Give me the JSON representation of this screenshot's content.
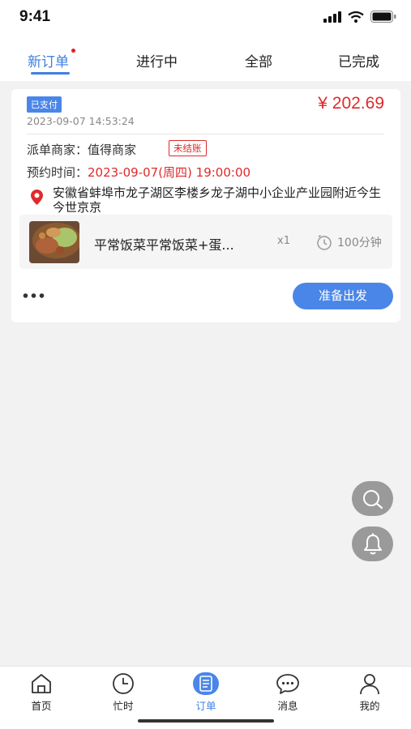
{
  "status_bar": {
    "time": "9:41"
  },
  "tabs": [
    {
      "label": "新订单",
      "active": true,
      "has_dot": true
    },
    {
      "label": "进行中",
      "active": false
    },
    {
      "label": "全部",
      "active": false
    },
    {
      "label": "已完成",
      "active": false
    }
  ],
  "order": {
    "status_badge": "已支付",
    "price": "¥ 202.69",
    "created_at": "2023-09-07 14:53:24",
    "merchant_label": "派单商家：值得商家",
    "settlement_badge": "未结账",
    "appointment_label": "预约时间：",
    "appointment_value": "2023-09-07(周四) 19:00:00",
    "address": "安徽省蚌埠市龙子湖区李楼乡龙子湖中小企业产业园附近今生今世京京",
    "item": {
      "name": "平常饭菜平常饭菜+蛋...",
      "quantity": "x1",
      "duration": "100分钟"
    },
    "action_button": "准备出发"
  },
  "bottom_nav": [
    {
      "label": "首页",
      "icon": "home-icon",
      "active": false
    },
    {
      "label": "忙时",
      "icon": "clock-icon",
      "active": false
    },
    {
      "label": "订单",
      "icon": "order-list-icon",
      "active": true
    },
    {
      "label": "消息",
      "icon": "chat-bubble-icon",
      "active": false
    },
    {
      "label": "我的",
      "icon": "person-icon",
      "active": false
    }
  ],
  "colors": {
    "accent": "#3f7fe0",
    "price": "#e0292b",
    "button": "#4a86e8"
  }
}
